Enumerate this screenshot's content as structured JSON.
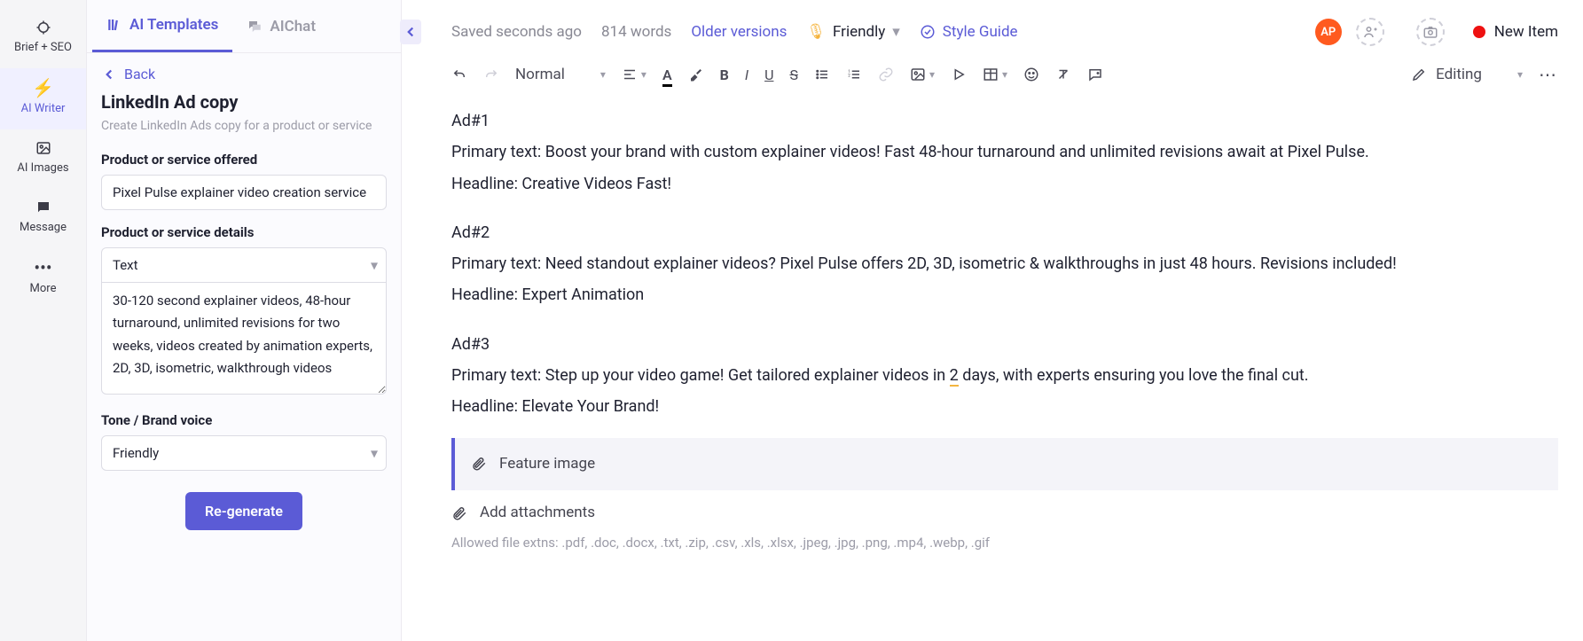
{
  "rail": {
    "items": [
      {
        "label": "Brief + SEO",
        "icon": "target-icon"
      },
      {
        "label": "AI Writer",
        "icon": "bolt-icon"
      },
      {
        "label": "AI Images",
        "icon": "image-icon"
      },
      {
        "label": "Message",
        "icon": "chat-icon"
      },
      {
        "label": "More",
        "icon": "dots-icon"
      }
    ]
  },
  "panel": {
    "tabs": {
      "templates": "AI Templates",
      "chat": "AIChat"
    },
    "back": "Back",
    "title": "LinkedIn Ad copy",
    "subtitle": "Create LinkedIn Ads copy for a product or service",
    "labels": {
      "offered": "Product or service offered",
      "details": "Product or service details",
      "tone": "Tone / Brand voice"
    },
    "values": {
      "offered": "Pixel Pulse explainer video creation service",
      "details_type": "Text",
      "details_text": "30-120 second explainer videos, 48-hour turnaround, unlimited revisions for two weeks, videos created by animation experts, 2D, 3D, isometric, walkthrough videos",
      "tone": "Friendly"
    },
    "regen": "Re-generate"
  },
  "topbar": {
    "saved": "Saved seconds ago",
    "words": "814 words",
    "older": "Older versions",
    "tone": "Friendly",
    "style": "Style Guide",
    "avatar": "AP",
    "newitem": "New Item"
  },
  "toolbar": {
    "normal": "Normal",
    "editing": "Editing"
  },
  "doc": {
    "ad1_h": "Ad#1",
    "ad1_p": "Primary text: Boost your brand with custom explainer videos! Fast 48-hour turnaround and unlimited revisions await at Pixel Pulse.",
    "ad1_hl": "Headline: Creative Videos Fast!",
    "ad2_h": "Ad#2",
    "ad2_p": "Primary text: Need standout explainer videos? Pixel Pulse offers 2D, 3D, isometric & walkthroughs in just 48 hours. Revisions included!",
    "ad2_hl": "Headline: Expert Animation",
    "ad3_h": "Ad#3",
    "ad3_p_a": "Primary text: Step up your video game! Get tailored explainer videos in ",
    "ad3_num": "2",
    "ad3_p_b": " days, with experts ensuring you love the final cut.",
    "ad3_hl": "Headline: Elevate Your Brand!",
    "feature": "Feature image",
    "attach": "Add attachments",
    "hint": "Allowed file extns: .pdf, .doc, .docx, .txt, .zip, .csv, .xls, .xlsx, .jpeg, .jpg, .png, .mp4, .webp, .gif"
  }
}
